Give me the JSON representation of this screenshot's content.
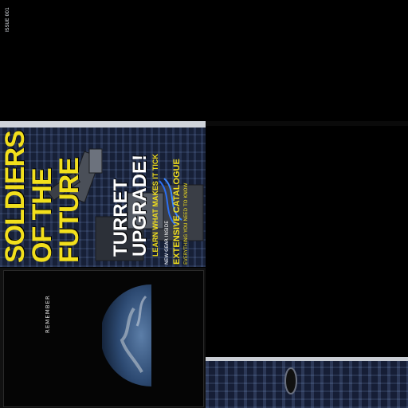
{
  "texture_atlas": {
    "cover": {
      "issue_line": "ISSUE 001",
      "title_lines": [
        "SOLDIERS",
        "OF THE",
        "FUTURE"
      ],
      "headline_lines": [
        "TURRET",
        "UPGRADE!"
      ],
      "headline_sub": "LEARN WHAT MAKES IT TICK",
      "blurb_small": "NEW GEAR INSIDE",
      "blurb_big": "EXTENSIVE CATALOGUE",
      "blurb_tail": "EVERYTHING YOU NEED TO KNOW",
      "accent_yellow": "#f2df1c",
      "bg_navy": "#1b2540"
    },
    "poster": {
      "vertical_text": "REMEMBER"
    }
  }
}
